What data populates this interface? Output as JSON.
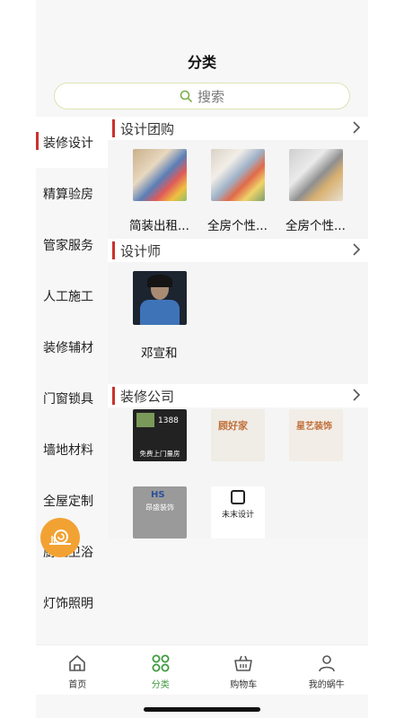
{
  "header": {
    "title": "分类"
  },
  "search": {
    "placeholder": "搜索"
  },
  "sidebar": {
    "items": [
      {
        "label": "装修设计",
        "active": true
      },
      {
        "label": "精算验房"
      },
      {
        "label": "管家服务"
      },
      {
        "label": "人工施工"
      },
      {
        "label": "装修辅材"
      },
      {
        "label": "门窗锁具"
      },
      {
        "label": "墙地材料"
      },
      {
        "label": "全屋定制"
      },
      {
        "label": "厨卫卫浴"
      },
      {
        "label": "灯饰照明"
      }
    ]
  },
  "sections": {
    "group": {
      "title": "设计团购",
      "items": [
        {
          "label": "简装出租..."
        },
        {
          "label": "全房个性..."
        },
        {
          "label": "全房个性..."
        }
      ]
    },
    "designer": {
      "title": "设计师",
      "items": [
        {
          "label": "邓宣和"
        }
      ]
    },
    "company": {
      "title": "装修公司",
      "logos": [
        {
          "text": "免费上门量房",
          "phone": "1388"
        },
        {
          "text": "顾好家"
        },
        {
          "text": "星艺装饰"
        },
        {
          "text": "HS",
          "sub": "昂盛装饰"
        },
        {
          "text": "未末设计"
        }
      ]
    }
  },
  "tabbar": {
    "tabs": [
      {
        "label": "首页",
        "icon": "home-icon"
      },
      {
        "label": "分类",
        "icon": "category-icon",
        "active": true
      },
      {
        "label": "购物车",
        "icon": "cart-icon"
      },
      {
        "label": "我的蜗牛",
        "icon": "profile-icon"
      }
    ]
  },
  "colors": {
    "accent": "#3f9a3f",
    "marker": "#c9322d",
    "search_border": "#d8e6b4"
  }
}
